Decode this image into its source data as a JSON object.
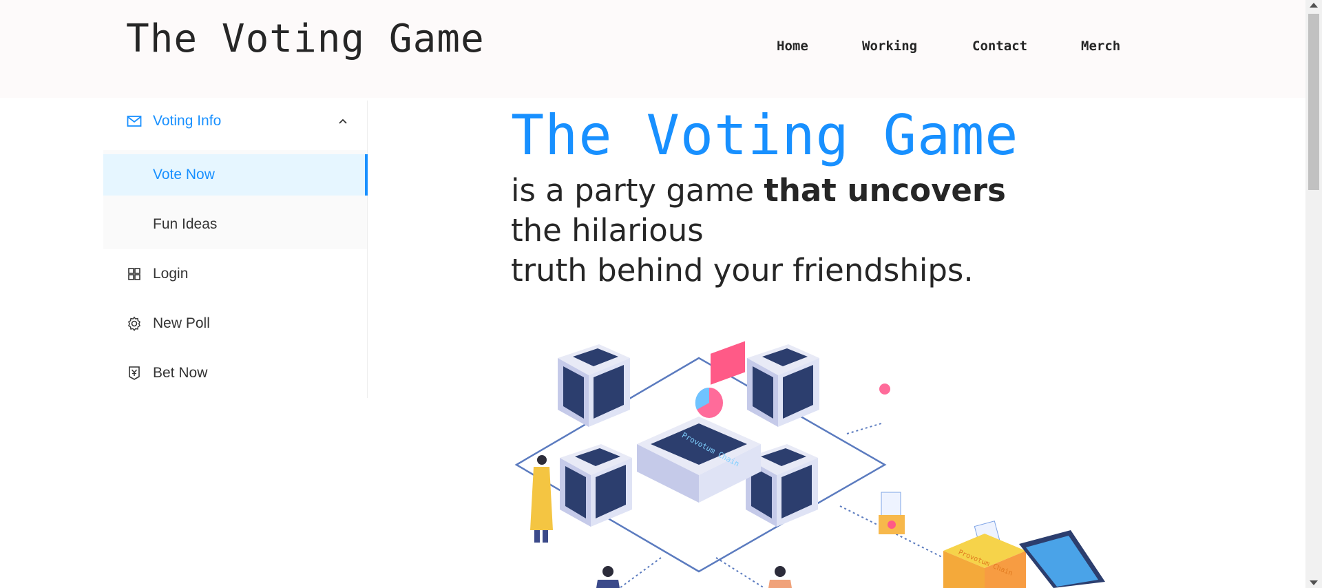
{
  "header": {
    "logo": "The Voting Game",
    "nav": [
      "Home",
      "Working",
      "Contact",
      "Merch"
    ]
  },
  "sidebar": {
    "items": [
      {
        "label": "Voting Info",
        "icon": "mail-icon",
        "expanded": true
      },
      {
        "label": "Vote Now",
        "selected": true
      },
      {
        "label": "Fun Ideas"
      },
      {
        "label": "Login",
        "icon": "appstore-icon"
      },
      {
        "label": "New Poll",
        "icon": "setting-icon"
      },
      {
        "label": "Bet Now",
        "icon": "money-collect-icon"
      }
    ]
  },
  "hero": {
    "title": "The Voting Game",
    "tagline_1": "is a party game ",
    "tagline_1_bold": "that uncovers",
    "tagline_2": "the hilarious",
    "tagline_3": "truth behind your friendships.",
    "illustration_text": "Provotum Chain",
    "illustration_label": "Provotum Chain"
  },
  "colors": {
    "accent": "#1890ff",
    "text": "#262626",
    "selected_bg": "#e6f6ff",
    "header_bg": "#fdfafa"
  }
}
